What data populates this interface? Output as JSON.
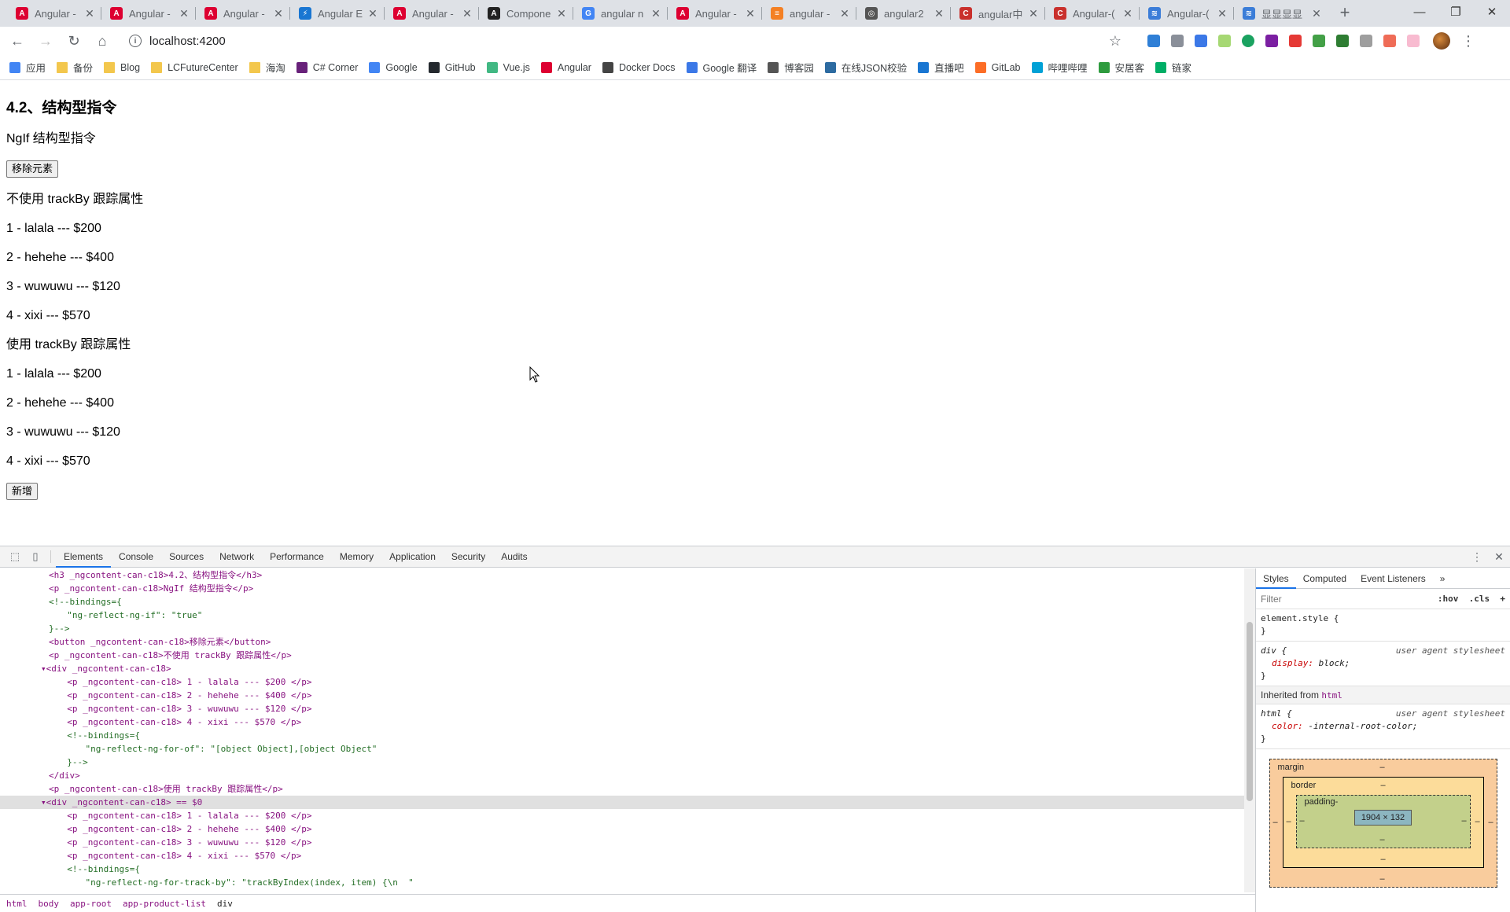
{
  "tabs": [
    {
      "title": "Angular -",
      "color": "#dd0031",
      "glyph": "A"
    },
    {
      "title": "Angular -",
      "color": "#dd0031",
      "glyph": "A"
    },
    {
      "title": "Angular -",
      "color": "#dd0031",
      "glyph": "A"
    },
    {
      "title": "Angular E",
      "color": "#1976d2",
      "glyph": "⚡"
    },
    {
      "title": "Angular -",
      "color": "#dd0031",
      "glyph": "A"
    },
    {
      "title": "Compone",
      "color": "#222222",
      "glyph": "A"
    },
    {
      "title": "angular n",
      "color": "#4285f4",
      "glyph": "G"
    },
    {
      "title": "Angular -",
      "color": "#dd0031",
      "glyph": "A"
    },
    {
      "title": "angular -",
      "color": "#f48024",
      "glyph": "≡"
    },
    {
      "title": "angular2",
      "color": "#555555",
      "glyph": "◎"
    },
    {
      "title": "angular中",
      "color": "#c9302c",
      "glyph": "C"
    },
    {
      "title": "Angular-(",
      "color": "#c9302c",
      "glyph": "C"
    },
    {
      "title": "Angular-(",
      "color": "#3b7dd8",
      "glyph": "≋"
    },
    {
      "title": "显显显显",
      "color": "#3b7dd8",
      "glyph": "≋"
    }
  ],
  "new_tab_label": "+",
  "window_controls": {
    "minimize": "—",
    "restore": "❐",
    "close": "✕"
  },
  "address": {
    "url": "localhost:4200"
  },
  "bookmarks": [
    {
      "label": "应用",
      "icon": "apps-icon"
    },
    {
      "label": "备份",
      "icon": "folder-icon"
    },
    {
      "label": "Blog",
      "icon": "folder-icon"
    },
    {
      "label": "LCFutureCenter",
      "icon": "folder-icon"
    },
    {
      "label": "海淘",
      "icon": "folder-icon"
    },
    {
      "label": "C# Corner",
      "icon": "csharp-icon"
    },
    {
      "label": "Google",
      "icon": "google-icon"
    },
    {
      "label": "GitHub",
      "icon": "github-icon"
    },
    {
      "label": "Vue.js",
      "icon": "vue-icon"
    },
    {
      "label": "Angular",
      "icon": "angular-icon"
    },
    {
      "label": "Docker Docs",
      "icon": "docker-icon"
    },
    {
      "label": "Google 翻译",
      "icon": "translate-icon"
    },
    {
      "label": "博客园",
      "icon": "cnblogs-icon"
    },
    {
      "label": "在线JSON校验",
      "icon": "json-icon"
    },
    {
      "label": "直播吧",
      "icon": "zhibo-icon"
    },
    {
      "label": "GitLab",
      "icon": "gitlab-icon"
    },
    {
      "label": "哔哩哔哩",
      "icon": "bilibili-icon"
    },
    {
      "label": "安居客",
      "icon": "anjuke-icon"
    },
    {
      "label": "链家",
      "icon": "lianjia-icon"
    }
  ],
  "page": {
    "heading": "4.2、结构型指令",
    "ngif_label": "NgIf 结构型指令",
    "remove_button": "移除元素",
    "no_trackby_label": "不使用 trackBy 跟踪属性",
    "list_a": [
      "1 - lalala --- $200",
      "2 - hehehe --- $400",
      "3 - wuwuwu --- $120",
      "4 - xixi --- $570"
    ],
    "trackby_label": "使用 trackBy 跟踪属性",
    "list_b": [
      "1 - lalala --- $200",
      "2 - hehehe --- $400",
      "3 - wuwuwu --- $120",
      "4 - xixi --- $570"
    ],
    "add_button": "新增"
  },
  "devtools": {
    "tabs": [
      "Elements",
      "Console",
      "Sources",
      "Network",
      "Performance",
      "Memory",
      "Application",
      "Security",
      "Audits"
    ],
    "active_tab": "Elements",
    "code_lines": [
      "<h3 _ngcontent-can-c18>4.2、结构型指令</h3>",
      "<p _ngcontent-can-c18>NgIf 结构型指令</p>",
      "<!--bindings={",
      "  \"ng-reflect-ng-if\": \"true\"",
      "}-->",
      "<button _ngcontent-can-c18>移除元素</button>",
      "<p _ngcontent-can-c18>不使用 trackBy 跟踪属性</p>",
      "▾<div _ngcontent-can-c18>",
      "  <p _ngcontent-can-c18> 1 - lalala --- $200 </p>",
      "  <p _ngcontent-can-c18> 2 - hehehe --- $400 </p>",
      "  <p _ngcontent-can-c18> 3 - wuwuwu --- $120 </p>",
      "  <p _ngcontent-can-c18> 4 - xixi --- $570 </p>",
      "  <!--bindings={",
      "    \"ng-reflect-ng-for-of\": \"[object Object],[object Object\"",
      "  }-->",
      "</div>",
      "<p _ngcontent-can-c18>使用 trackBy 跟踪属性</p>",
      "▾<div _ngcontent-can-c18> == $0",
      "  <p _ngcontent-can-c18> 1 - lalala --- $200 </p>",
      "  <p _ngcontent-can-c18> 2 - hehehe --- $400 </p>",
      "  <p _ngcontent-can-c18> 3 - wuwuwu --- $120 </p>",
      "  <p _ngcontent-can-c18> 4 - xixi --- $570 </p>",
      "  <!--bindings={",
      "    \"ng-reflect-ng-for-track-by\": \"trackByIndex(index, item) {\\n  \""
    ],
    "breadcrumbs": [
      "html",
      "body",
      "app-root",
      "app-product-list",
      "div"
    ],
    "styles_tabs": [
      "Styles",
      "Computed",
      "Event Listeners",
      "»"
    ],
    "filter_placeholder": "Filter",
    "filter_hov": ":hov",
    "filter_cls": ".cls",
    "filter_add": "+",
    "element_style": "element.style {",
    "div_rule": {
      "selector": "div {",
      "source": "user agent stylesheet",
      "prop": "display",
      "value": "block;"
    },
    "inherited_label": "Inherited from",
    "inherited_tag": "html",
    "html_rule": {
      "selector": "html {",
      "source": "user agent stylesheet",
      "prop": "color",
      "value": "-internal-root-color;"
    },
    "closing_brace": "}",
    "box_model": {
      "margin_label": "margin",
      "border_label": "border",
      "padding_label": "padding-",
      "content_size": "1904 × 132",
      "dash": "–"
    }
  }
}
